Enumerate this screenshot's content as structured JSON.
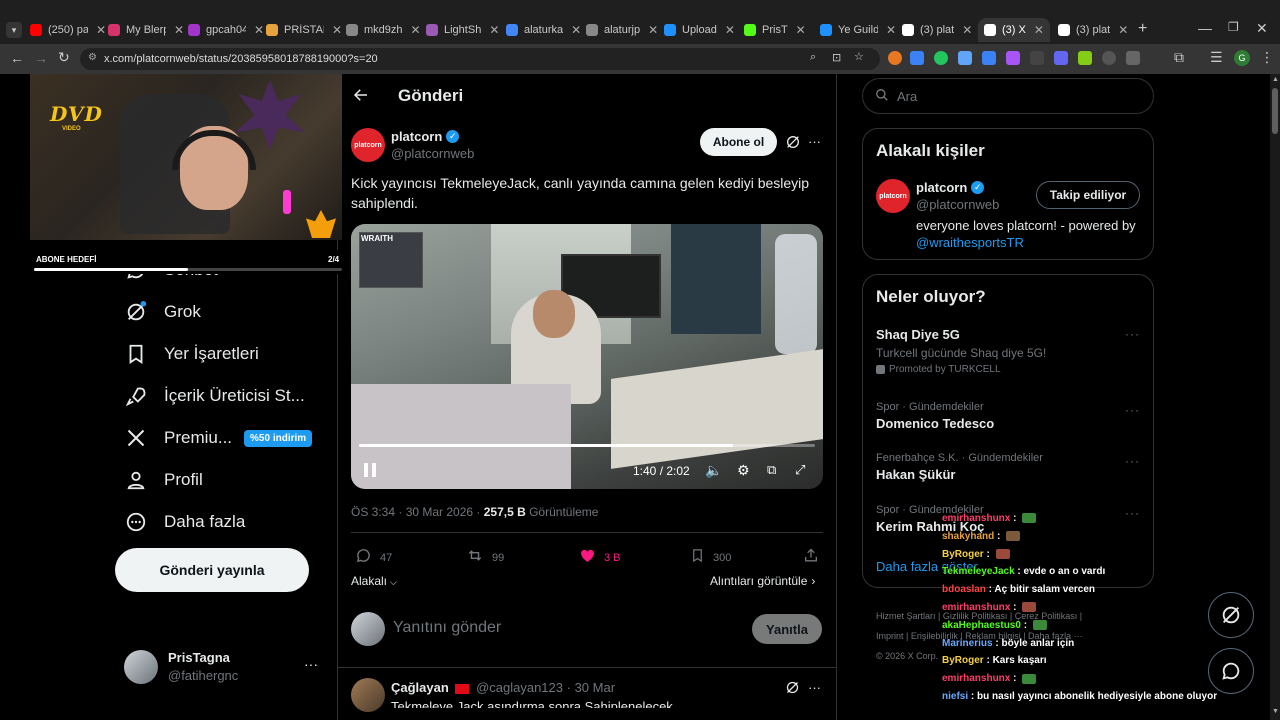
{
  "browser": {
    "tabs": [
      {
        "label": "(250) pa",
        "color": "#ff0000"
      },
      {
        "label": "My Blerp",
        "color": "#d6336c"
      },
      {
        "label": "gpcah04",
        "color": "#a134c9"
      },
      {
        "label": "PRİSTAN",
        "color": "#e6a23c"
      },
      {
        "label": "mkd9zh",
        "color": "#888888"
      },
      {
        "label": "LightSh",
        "color": "#9b59b6"
      },
      {
        "label": "alaturka",
        "color": "#4285f4"
      },
      {
        "label": "alaturjp",
        "color": "#888888"
      },
      {
        "label": "Upload",
        "color": "#1e90ff"
      },
      {
        "label": "PrisT",
        "color": "#53fc18"
      },
      {
        "label": "Ye Guild",
        "color": "#1e90ff"
      },
      {
        "label": "(3) plat",
        "color": "#ffffff"
      },
      {
        "label": "(3) X",
        "color": "#ffffff"
      },
      {
        "label": "(3) plat",
        "color": "#ffffff"
      }
    ],
    "url": "x.com/platcornweb/status/2038595801878819000?s=20"
  },
  "stream": {
    "dvd_logo": "DVD",
    "dvd_sub": "VIDEO",
    "goal_label": "ABONE HEDEFİ",
    "goal_progress": "2/4"
  },
  "left_nav": {
    "items": [
      {
        "label": "Sohbet",
        "icon": "chat-icon"
      },
      {
        "label": "Grok",
        "icon": "grok-icon"
      },
      {
        "label": "Yer İşaretleri",
        "icon": "bookmark-icon"
      },
      {
        "label": "İçerik Üreticisi St...",
        "icon": "rocket-icon"
      },
      {
        "label": "Premiu...",
        "icon": "x-logo-icon"
      },
      {
        "label": "Profil",
        "icon": "person-icon"
      },
      {
        "label": "Daha fazla",
        "icon": "more-circle-icon"
      }
    ],
    "premium_badge": "%50 indirim",
    "post_button": "Gönderi yayınla",
    "account": {
      "name": "PrisTagna",
      "handle": "@fatihergnc"
    }
  },
  "main": {
    "header_title": "Gönderi",
    "post": {
      "author_name": "platcorn",
      "author_handle": "@platcornweb",
      "avatar_text": "platcorn",
      "subscribe_label": "Abone ol",
      "text": "Kick yayıncısı TekmeleyeJack, canlı yayında camına gelen kediyi besleyip sahiplendi.",
      "video": {
        "watermark": "WRAITH",
        "time": "1:40 / 2:02",
        "progress": 0.82
      },
      "meta_time": "ÖS 3:34 · 30 Mar 2026 · ",
      "views_count": "257,5 B",
      "views_label": " Görüntüleme",
      "actions": {
        "replies": "47",
        "reposts": "99",
        "likes": "3 B",
        "bookmarks": "300"
      },
      "relevant_label": "Alakalı",
      "quotes_label": "Alıntıları görüntüle"
    },
    "reply_placeholder": "Yanıtını gönder",
    "reply_button": "Yanıtla",
    "comment": {
      "name": "Çağlayan",
      "handle": "@caglayan123",
      "date": "· 30 Mar",
      "text": "Tekmeleye Jack aşındırma sonra Sahiplenelecek"
    }
  },
  "right": {
    "search_placeholder": "Ara",
    "related": {
      "title": "Alakalı kişiler",
      "name": "platcorn",
      "handle": "@platcornweb",
      "button": "Takip ediliyor",
      "bio": "everyone loves platcorn! - powered by",
      "bio_link": "@wraithesportsTR"
    },
    "trends": {
      "title": "Neler oluyor?",
      "items": [
        {
          "meta": "",
          "name": "Shaq Diye 5G",
          "desc": "Turkcell gücünde Shaq diye 5G!",
          "promo": "Promoted by TURKCELL"
        },
        {
          "meta": "Spor · Gündemdekiler",
          "name": "Domenico Tedesco"
        },
        {
          "meta": "Fenerbahçe S.K. · Gündemdekiler",
          "name": "Hakan Şükür"
        },
        {
          "meta": "Spor · Gündemdekiler",
          "name": "Kerim Rahmi Koç"
        }
      ],
      "more": "Daha fazla göster"
    },
    "footer": {
      "line1": "Hizmet Şartları  |  Gizlilik Politikası  |  Çerez Politikası  |",
      "line2": "Imprint  |  Erişilebilirlik  |  Reklam bilgisi  |  Daha fazla ···",
      "line3": "© 2026 X Corp."
    }
  },
  "chat_overlay": [
    {
      "user": "emirhanshunx",
      "color": "#ff3b6b",
      "msg": ""
    },
    {
      "user": "shakyhand",
      "color": "#e6a23c",
      "msg": ""
    },
    {
      "user": "ByRoger",
      "color": "#f5d142",
      "msg": ""
    },
    {
      "user": "TekmeleyeJack",
      "color": "#53fc18",
      "msg": "evde o an o vardı"
    },
    {
      "user": "bdoaslan",
      "color": "#ff4444",
      "msg": "Aç bitir salam vercen"
    },
    {
      "user": "emirhanshunx",
      "color": "#ff3b6b",
      "msg": ""
    },
    {
      "user": "akaHephaestus0",
      "color": "#53fc18",
      "msg": ""
    },
    {
      "user": "Marinerius",
      "color": "#6aa8ff",
      "msg": "böyle anlar için"
    },
    {
      "user": "ByRoger",
      "color": "#f5d142",
      "msg": "Kars kaşarı"
    },
    {
      "user": "emirhanshunx",
      "color": "#ff3b6b",
      "msg": ""
    },
    {
      "user": "niefsi",
      "color": "#6aa8ff",
      "msg": "bu nasıl yayıncı abonelik hediyesiyle abone oluyor"
    }
  ]
}
